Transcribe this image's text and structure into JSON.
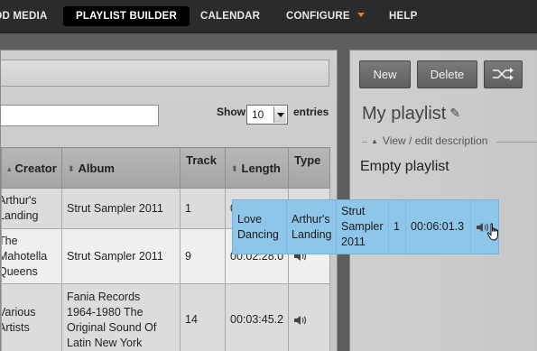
{
  "nav": {
    "items": [
      {
        "label": "DD MEDIA",
        "active": false
      },
      {
        "label": "PLAYLIST BUILDER",
        "active": true
      },
      {
        "label": "CALENDAR",
        "active": false
      },
      {
        "label": "CONFIGURE",
        "active": false,
        "has_dropdown": true
      },
      {
        "label": "HELP",
        "active": false
      }
    ],
    "dropdown_color": "#e8732a"
  },
  "library": {
    "search": {
      "value": ""
    },
    "show_label": "Show",
    "page_size": "10",
    "entries_label": "entries",
    "columns": [
      {
        "label": "Creator",
        "sortable": true
      },
      {
        "label": "Album",
        "sortable": true
      },
      {
        "label": "Track",
        "sortable": false
      },
      {
        "label": "Length",
        "sortable": true
      },
      {
        "label": "Type",
        "sortable": false
      }
    ],
    "rows": [
      {
        "creator": "Arthur's\nLanding",
        "album": "Strut Sampler 2011",
        "track": "1",
        "length": "00:06:01.3",
        "type_icon": "speaker-icon"
      },
      {
        "creator": "The\nMahotella\nQueens",
        "album": "Strut Sampler 2011",
        "track": "9",
        "length": "00:02:28.0",
        "type_icon": "speaker-icon"
      },
      {
        "creator": "Various\nArtists",
        "album": "Fania Records\n1964-1980 The\nOriginal Sound Of\nLatin New York",
        "track": "14",
        "length": "00:03:45.2",
        "type_icon": "speaker-icon"
      }
    ]
  },
  "playlist": {
    "buttons": {
      "new": "New",
      "delete": "Delete",
      "shuffle_icon": "shuffle-icon"
    },
    "title": "My playlist",
    "edit_icon": "pencil-icon",
    "desc_link": "View / edit description",
    "empty_text": "Empty playlist"
  },
  "drag_row": {
    "title": "Love\nDancing",
    "creator": "Arthur's\nLanding",
    "album": "Strut\nSampler\n2011",
    "track": "1",
    "length": "00:06:01.3",
    "type_icon": "speaker-icon",
    "highlight_color": "#8ec6ea"
  }
}
